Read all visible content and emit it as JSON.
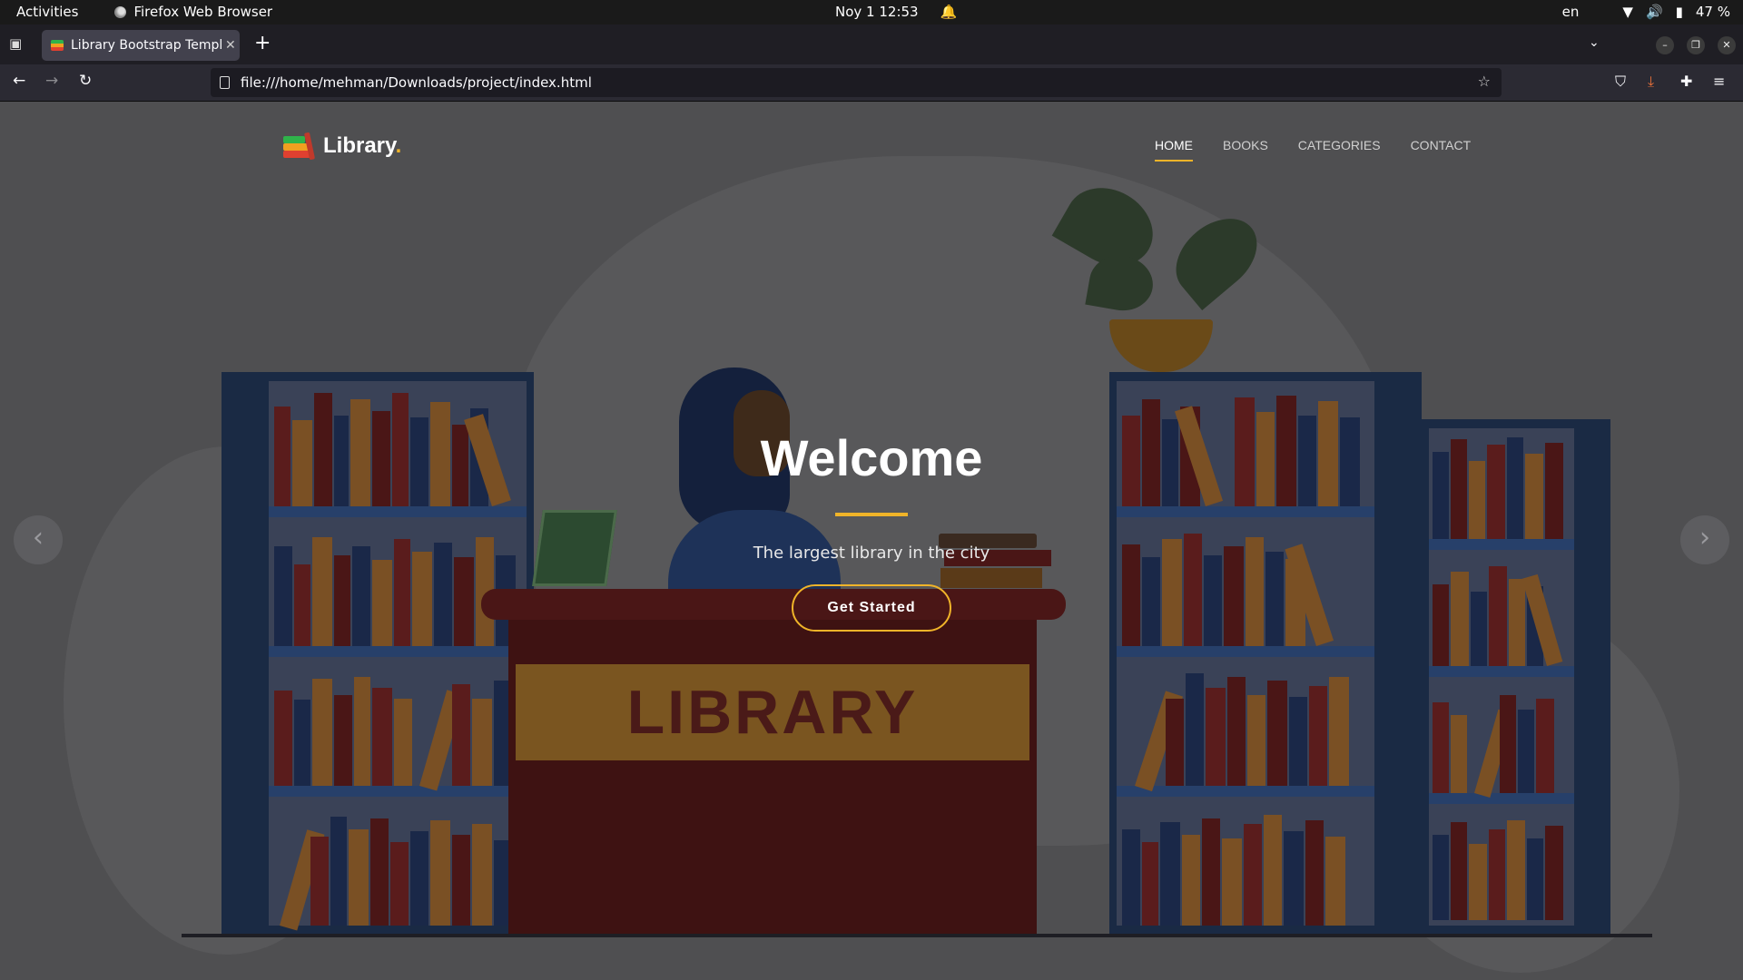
{
  "system_bar": {
    "activities": "Activities",
    "app_name": "Firefox Web Browser",
    "datetime": "Noy 1  12:53",
    "language": "en",
    "battery": "47 %"
  },
  "browser": {
    "tab_title": "Library Bootstrap Templ",
    "url": "file:///home/mehman/Downloads/project/index.html"
  },
  "site": {
    "logo_text": "Library",
    "logo_dot": ".",
    "nav": [
      "HOME",
      "BOOKS",
      "CATEGORIES",
      "CONTACT"
    ],
    "active_nav": "HOME",
    "accent_color": "#f0b429"
  },
  "hero": {
    "title": "Welcome",
    "subtitle": "The largest library in the city",
    "button": "Get Started",
    "desk_sign": "LIBRARY"
  }
}
